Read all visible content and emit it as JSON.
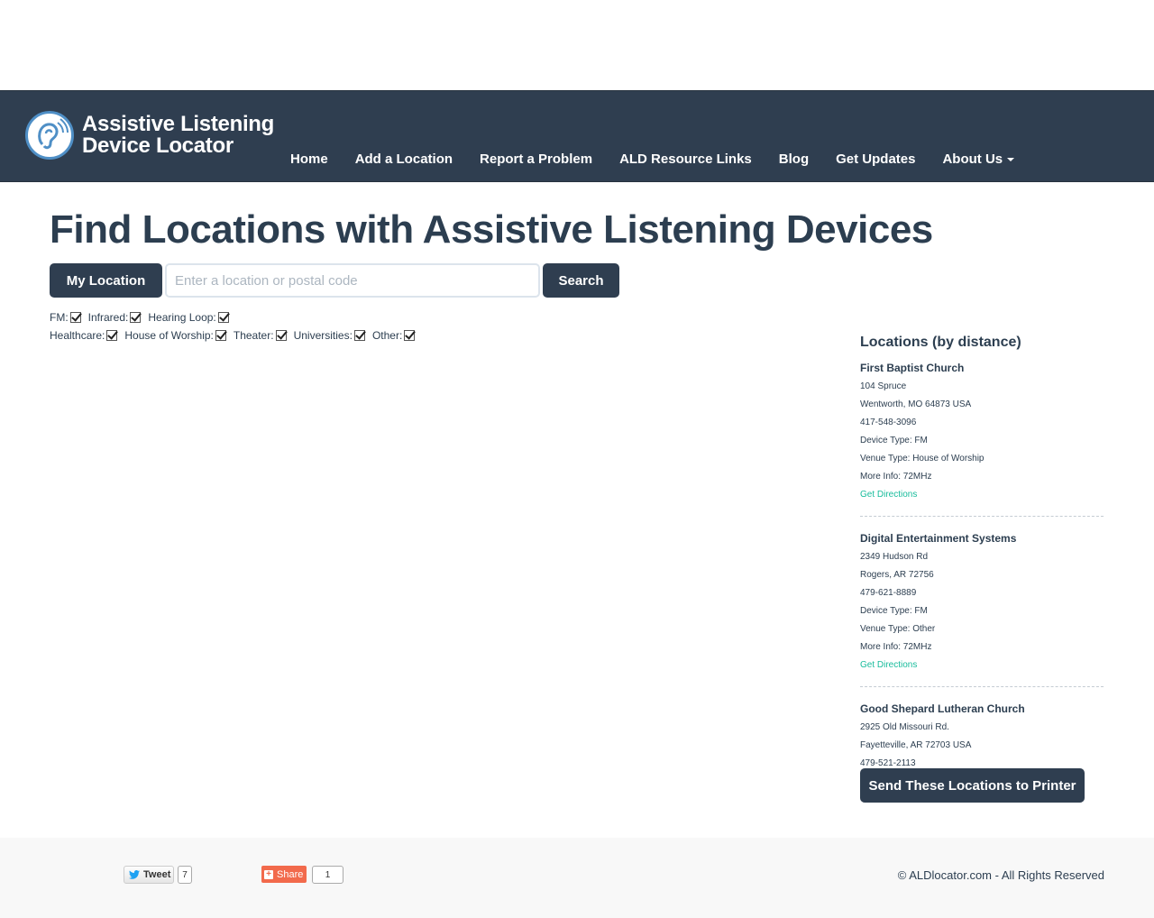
{
  "brand": {
    "line1": "Assistive Listening",
    "line2": "Device Locator",
    "logo_icon": "ear-icon"
  },
  "nav": {
    "items": [
      {
        "label": "Home"
      },
      {
        "label": "Add a Location"
      },
      {
        "label": "Report a Problem"
      },
      {
        "label": "ALD Resource Links"
      },
      {
        "label": "Blog"
      },
      {
        "label": "Get Updates"
      },
      {
        "label": "About Us"
      }
    ]
  },
  "page": {
    "title": "Find Locations with Assistive Listening Devices"
  },
  "search": {
    "my_location_label": "My Location",
    "placeholder": "Enter a location or postal code",
    "value": "",
    "search_label": "Search"
  },
  "filters": {
    "devices": [
      {
        "label": "FM:",
        "checked": true
      },
      {
        "label": "Infrared:",
        "checked": true
      },
      {
        "label": "Hearing Loop:",
        "checked": true
      }
    ],
    "venues": [
      {
        "label": "Healthcare:",
        "checked": true
      },
      {
        "label": "House of Worship:",
        "checked": true
      },
      {
        "label": "Theater:",
        "checked": true
      },
      {
        "label": "Universities:",
        "checked": true
      },
      {
        "label": "Other:",
        "checked": true
      }
    ]
  },
  "results": {
    "title": "Locations (by distance)",
    "locations": [
      {
        "name": "First Baptist Church",
        "address": "104 Spruce",
        "city": "Wentworth, MO 64873 USA",
        "phone": "417-548-3096",
        "device": "Device Type: FM",
        "venue": "Venue Type: House of Worship",
        "info": "More Info: 72MHz",
        "link": "Get Directions"
      },
      {
        "name": "Digital Entertainment Systems",
        "address": "2349 Hudson Rd",
        "city": "Rogers, AR 72756",
        "phone": "479-621-8889",
        "device": "Device Type: FM",
        "venue": "Venue Type: Other",
        "info": "More Info: 72MHz",
        "link": "Get Directions"
      },
      {
        "name": "Good Shepard Lutheran Church",
        "address": "2925 Old Missouri Rd.",
        "city": "Fayetteville, AR 72703 USA",
        "phone": "479-521-2113"
      }
    ],
    "print_label": "Send These Locations to Printer"
  },
  "footer": {
    "tweet_label": "Tweet",
    "tweet_count": "7",
    "share_label": "Share",
    "share_count": "1",
    "copyright": "© ALDlocator.com - All Rights Reserved"
  },
  "colors": {
    "navbar": "#2f3e50",
    "primary_text": "#2c3e50",
    "link": "#18bc9c",
    "share": "#f26a4c"
  }
}
